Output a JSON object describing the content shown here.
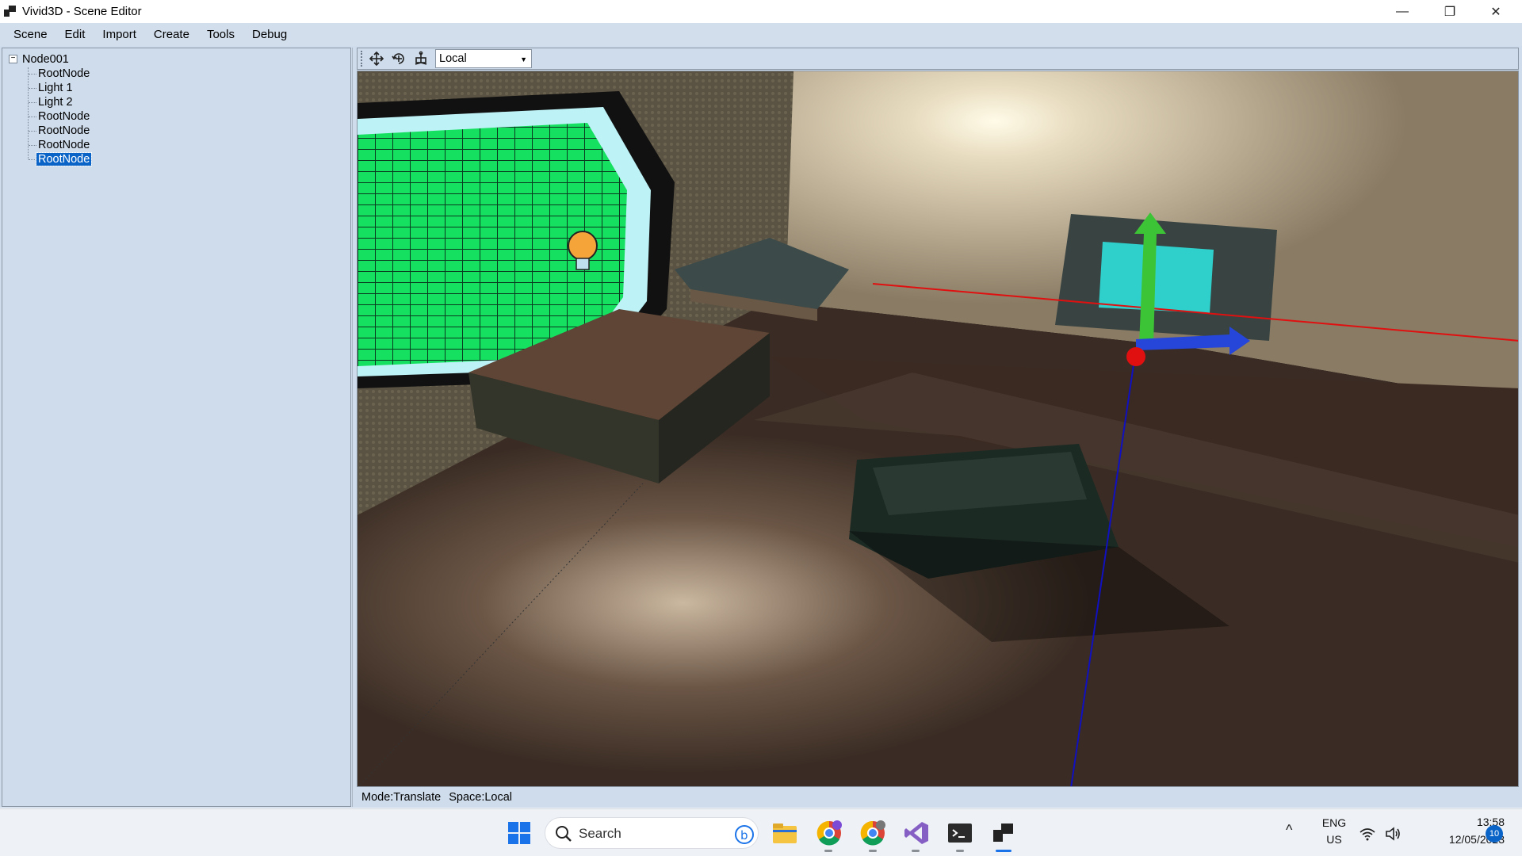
{
  "window": {
    "title": "Vivid3D - Scene Editor",
    "minimize_glyph": "—",
    "restore_glyph": "❐",
    "close_glyph": "✕"
  },
  "menu": [
    "Scene",
    "Edit",
    "Import",
    "Create",
    "Tools",
    "Debug"
  ],
  "tree": {
    "expander": "−",
    "root": "Node001",
    "children": [
      "RootNode",
      "Light 1",
      "Light 2",
      "RootNode",
      "RootNode",
      "RootNode",
      "RootNode"
    ],
    "selected_index": 6
  },
  "toolbar": {
    "tools": [
      "translate-icon",
      "rotate-icon",
      "scale-icon"
    ],
    "space_value": "Local",
    "dropdown_arrow": "▼"
  },
  "viewport": {
    "gizmo_colors": {
      "y": "#3dc436",
      "z": "#2546d8",
      "x": "#e01010"
    }
  },
  "status": {
    "mode": "Mode:Translate",
    "space": "Space:Local"
  },
  "taskbar": {
    "search_label": "Search",
    "lang_line1": "ENG",
    "lang_line2": "US",
    "time": "13:58",
    "date": "12/05/2023",
    "notification_count": "10",
    "chevron": "^"
  }
}
